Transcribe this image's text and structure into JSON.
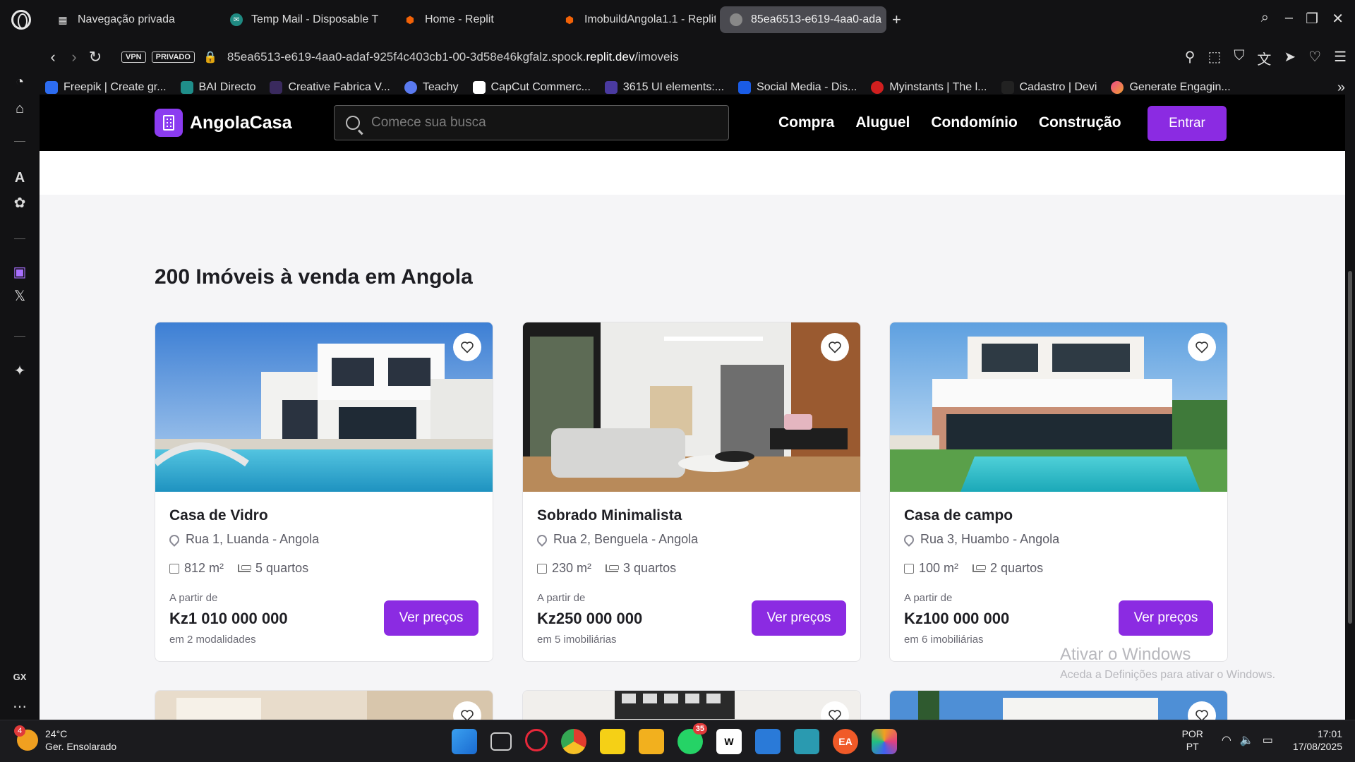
{
  "browser": {
    "tabs": [
      {
        "label": "Navegação privada",
        "icon": "private-grid-icon"
      },
      {
        "label": "Temp Mail - Disposable T",
        "icon": "tempmail-icon"
      },
      {
        "label": "Home - Replit",
        "icon": "replit-icon"
      },
      {
        "label": "ImobuildAngola1.1 - Replit",
        "icon": "replit-icon"
      },
      {
        "label": "85ea6513-e619-4aa0-ada",
        "icon": "globe-icon"
      }
    ],
    "vpn_badge": "VPN",
    "private_badge": "PRIVADO",
    "url_prefix": "85ea6513-e619-4aa0-adaf-925f4c403cb1-00-3d58e46kgfalz.spock.",
    "url_domain": "replit.dev",
    "url_path": "/imoveis",
    "bookmarks": [
      "Freepik | Create gr...",
      "BAI Directo",
      "Creative Fabrica V...",
      "Teachy",
      "CapCut Commerc...",
      "3615 UI elements:...",
      "Social Media - Dis...",
      "Myinstants | The l...",
      "Cadastro | Devi",
      "Generate Engagin..."
    ],
    "sidebar_label": "GX"
  },
  "site": {
    "brand": "AngolaCasa",
    "search_placeholder": "Comece sua busca",
    "menu": [
      "Compra",
      "Aluguel",
      "Condomínio",
      "Construção"
    ],
    "login_label": "Entrar",
    "section_title": "200 Imóveis à venda em Angola",
    "listings": [
      {
        "title": "Casa de Vidro",
        "location": "Rua 1, Luanda - Angola",
        "area": "812 m²",
        "rooms": "5 quartos",
        "from_label": "A partir de",
        "price": "Kz1 010 000 000",
        "sub": "em 2 modalidades",
        "button": "Ver preços"
      },
      {
        "title": "Sobrado Minimalista",
        "location": "Rua 2, Benguela - Angola",
        "area": "230 m²",
        "rooms": "3 quartos",
        "from_label": "A partir de",
        "price": "Kz250 000 000",
        "sub": "em 5 imobiliárias",
        "button": "Ver preços"
      },
      {
        "title": "Casa de campo",
        "location": "Rua 3, Huambo - Angola",
        "area": "100 m²",
        "rooms": "2 quartos",
        "from_label": "A partir de",
        "price": "Kz100 000 000",
        "sub": "em 6 imobiliárias",
        "button": "Ver preços"
      }
    ],
    "accent_color": "#8b2be2"
  },
  "watermark": {
    "line1": "Ativar o Windows",
    "line2": "Aceda a Definições para ativar o Windows."
  },
  "taskbar": {
    "weather_badge": "4",
    "temperature": "24°C",
    "condition": "Ger. Ensolarado",
    "whatsapp_count": "35",
    "lang1": "POR",
    "lang2": "PT",
    "time": "17:01",
    "date": "17/08/2025"
  }
}
